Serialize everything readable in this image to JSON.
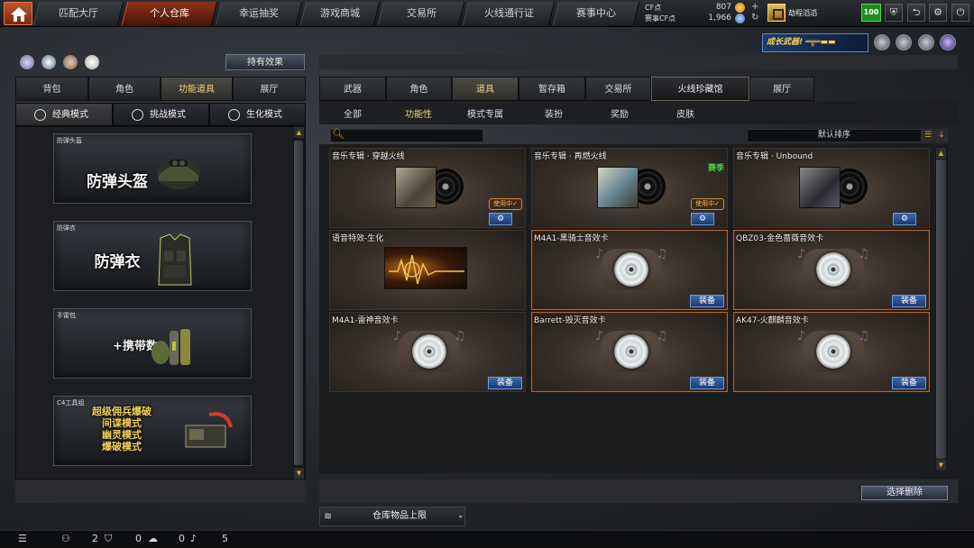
{
  "nav": {
    "tabs": [
      "匹配大厅",
      "个人仓库",
      "幸运抽奖",
      "游戏商城",
      "交易所",
      "火线通行证",
      "赛事中心"
    ],
    "active_index": 1
  },
  "currency": {
    "cf_label": "CF点",
    "cf_value": "807",
    "cfs_label": "赛事CF点",
    "cfs_value": "1,966"
  },
  "player": {
    "name": "劫程滔滔",
    "level": "100"
  },
  "left": {
    "effect_button": "持有效果",
    "tabs": [
      "背包",
      "角色",
      "功能道具",
      "展厅"
    ],
    "active_tab": 2,
    "modes": [
      "经典模式",
      "挑战模式",
      "生化模式"
    ],
    "cards": [
      {
        "category": "防弹头盔",
        "title": "防弹头盔"
      },
      {
        "category": "防弹衣",
        "title": "防弹衣"
      },
      {
        "category": "手雷包",
        "title": "+携带数"
      },
      {
        "category": "C4工具组",
        "title": "超级佣兵爆破",
        "lines": [
          "间谍模式",
          "幽灵模式",
          "爆破模式"
        ]
      }
    ]
  },
  "right": {
    "banner": "成长武器!",
    "tabs": [
      "武器",
      "角色",
      "道具",
      "暂存箱",
      "交易所",
      "火线珍藏馆",
      "展厅"
    ],
    "active_tab": 2,
    "subtabs": [
      "全部",
      "功能性",
      "模式专属",
      "装扮",
      "奖励",
      "皮肤"
    ],
    "active_subtab": 1,
    "sort_label": "默认排序",
    "items": [
      {
        "title": "音乐专辑 · 穿越火线",
        "status": "使用中✓"
      },
      {
        "title": "音乐专辑 · 再燃火线",
        "status": "使用中✓",
        "badge": "赛季"
      },
      {
        "title": "音乐专辑 · Unbound"
      },
      {
        "title": "语音特效-生化"
      },
      {
        "title": "M4A1-黑骑士音效卡",
        "button": "装备"
      },
      {
        "title": "QBZ03-金色蔷薇音效卡",
        "button": "装备"
      },
      {
        "title": "M4A1-雷神音效卡",
        "button": "装备"
      },
      {
        "title": "Barrett-毁灭音效卡",
        "button": "装备"
      },
      {
        "title": "AK47-火麒麟音效卡",
        "button": "装备"
      }
    ],
    "delete_button": "选择删除",
    "storage_label": "仓库物品上限"
  },
  "statusbar": {
    "count_a": "2",
    "count_b": "0",
    "count_c": "0",
    "count_d": "5"
  },
  "colors": {
    "accent_gold": "#f2d37a",
    "active_nav": "#8a3318",
    "equip_blue": "#3b66ad",
    "rare_border": "#b5622c",
    "season_green": "#46d146"
  }
}
